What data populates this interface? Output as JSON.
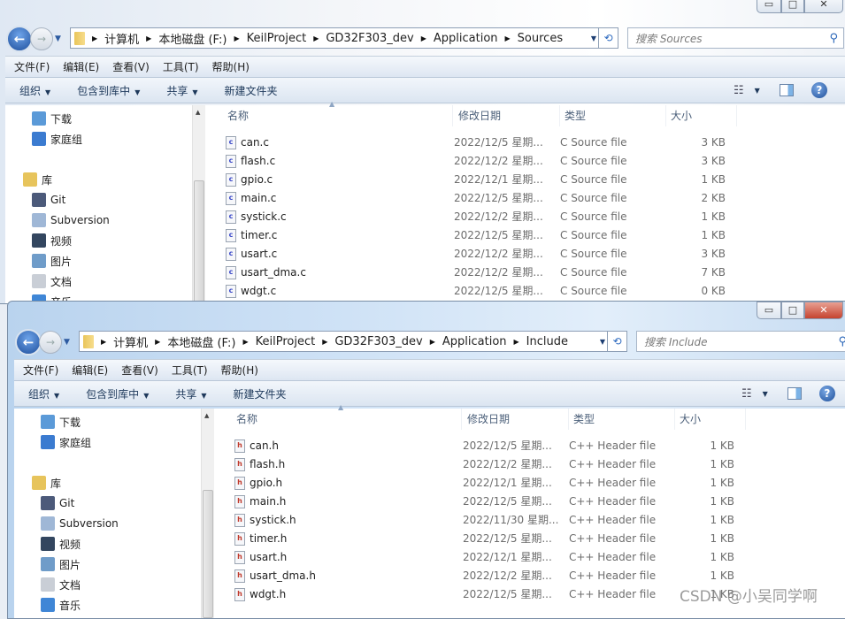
{
  "menu": [
    "文件(F)",
    "编辑(E)",
    "查看(V)",
    "工具(T)",
    "帮助(H)"
  ],
  "toolbar": {
    "organize": "组织",
    "include_library": "包含到库中",
    "share": "共享",
    "new_folder": "新建文件夹"
  },
  "nav": {
    "downloads": "下载",
    "homegroup": "家庭组",
    "libraries": "库",
    "git": "Git",
    "subversion": "Subversion",
    "videos": "视频",
    "pictures": "图片",
    "documents": "文档",
    "music": "音乐"
  },
  "columns": {
    "name": "名称",
    "date": "修改日期",
    "type": "类型",
    "size": "大小"
  },
  "caption": {
    "minimize": "▭",
    "maximize": "□",
    "close": "✕"
  },
  "windows": [
    {
      "breadcrumb": [
        "计算机",
        "本地磁盘 (F:)",
        "KeilProject",
        "GD32F303_dev",
        "Application",
        "Sources"
      ],
      "search_placeholder": "搜索 Sources",
      "icon_letter": "c",
      "icon_color": "#3a48c8",
      "files": [
        {
          "name": "can.c",
          "date": "2022/12/5 星期...",
          "type": "C Source file",
          "size": "3 KB"
        },
        {
          "name": "flash.c",
          "date": "2022/12/2 星期...",
          "type": "C Source file",
          "size": "3 KB"
        },
        {
          "name": "gpio.c",
          "date": "2022/12/1 星期...",
          "type": "C Source file",
          "size": "1 KB"
        },
        {
          "name": "main.c",
          "date": "2022/12/5 星期...",
          "type": "C Source file",
          "size": "2 KB"
        },
        {
          "name": "systick.c",
          "date": "2022/12/2 星期...",
          "type": "C Source file",
          "size": "1 KB"
        },
        {
          "name": "timer.c",
          "date": "2022/12/5 星期...",
          "type": "C Source file",
          "size": "1 KB"
        },
        {
          "name": "usart.c",
          "date": "2022/12/2 星期...",
          "type": "C Source file",
          "size": "3 KB"
        },
        {
          "name": "usart_dma.c",
          "date": "2022/12/2 星期...",
          "type": "C Source file",
          "size": "7 KB"
        },
        {
          "name": "wdgt.c",
          "date": "2022/12/5 星期...",
          "type": "C Source file",
          "size": "0 KB"
        }
      ]
    },
    {
      "breadcrumb": [
        "计算机",
        "本地磁盘 (F:)",
        "KeilProject",
        "GD32F303_dev",
        "Application",
        "Include"
      ],
      "search_placeholder": "搜索 Include",
      "icon_letter": "h",
      "icon_color": "#c0392b",
      "files": [
        {
          "name": "can.h",
          "date": "2022/12/5 星期...",
          "type": "C++ Header file",
          "size": "1 KB"
        },
        {
          "name": "flash.h",
          "date": "2022/12/2 星期...",
          "type": "C++ Header file",
          "size": "1 KB"
        },
        {
          "name": "gpio.h",
          "date": "2022/12/1 星期...",
          "type": "C++ Header file",
          "size": "1 KB"
        },
        {
          "name": "main.h",
          "date": "2022/12/5 星期...",
          "type": "C++ Header file",
          "size": "1 KB"
        },
        {
          "name": "systick.h",
          "date": "2022/11/30 星期...",
          "type": "C++ Header file",
          "size": "1 KB"
        },
        {
          "name": "timer.h",
          "date": "2022/12/5 星期...",
          "type": "C++ Header file",
          "size": "1 KB"
        },
        {
          "name": "usart.h",
          "date": "2022/12/1 星期...",
          "type": "C++ Header file",
          "size": "1 KB"
        },
        {
          "name": "usart_dma.h",
          "date": "2022/12/2 星期...",
          "type": "C++ Header file",
          "size": "1 KB"
        },
        {
          "name": "wdgt.h",
          "date": "2022/12/5 星期...",
          "type": "C++ Header file",
          "size": "1 KB"
        }
      ]
    }
  ],
  "watermark": "CSDN @小吴同学啊"
}
